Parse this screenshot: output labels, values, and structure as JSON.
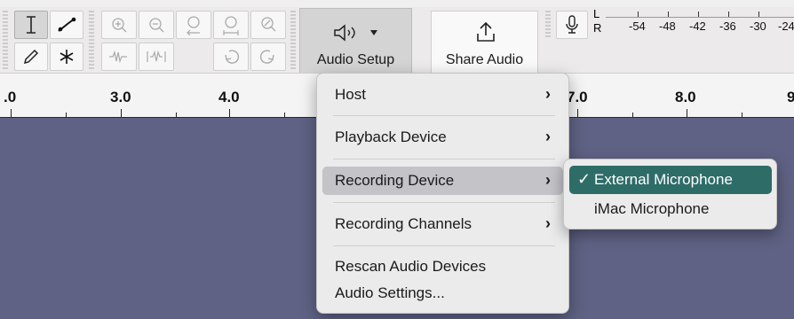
{
  "toolbar": {
    "tools_label": "tools",
    "audio_setup_label": "Audio Setup",
    "share_audio_label": "Share Audio",
    "meter": {
      "channels": [
        "L",
        "R"
      ],
      "scale": [
        "-54",
        "-48",
        "-42",
        "-36",
        "-30",
        "-24"
      ]
    }
  },
  "ruler": {
    "labels": [
      ".0",
      "3.0",
      "4.0",
      "7.0",
      "8.0",
      "9"
    ]
  },
  "menu": {
    "items": [
      {
        "label": "Host",
        "submenu": true
      },
      {
        "label": "Playback Device",
        "submenu": true
      },
      {
        "label": "Recording Device",
        "submenu": true,
        "highlighted": true
      },
      {
        "label": "Recording Channels",
        "submenu": true
      },
      {
        "label": "Rescan Audio Devices",
        "submenu": false
      },
      {
        "label": "Audio Settings...",
        "submenu": false
      }
    ]
  },
  "submenu": {
    "items": [
      {
        "label": "External Microphone",
        "checked": true,
        "check": "✓"
      },
      {
        "label": "iMac Microphone",
        "checked": false
      }
    ]
  },
  "colors": {
    "track_bg": "#5f6284",
    "menu_highlight": "#c3c3c8",
    "submenu_selected": "#2e6c68"
  }
}
